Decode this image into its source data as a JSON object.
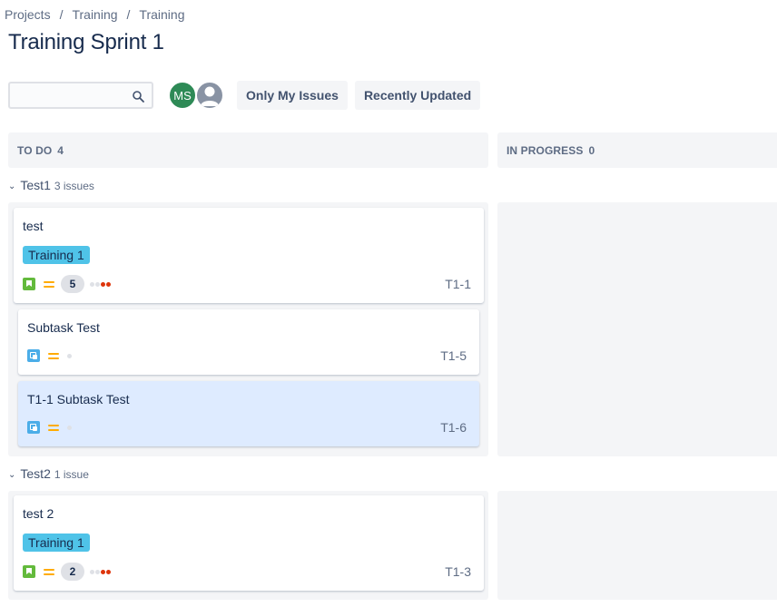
{
  "breadcrumb": [
    "Projects",
    "Training",
    "Training"
  ],
  "page_title": "Training Sprint 1",
  "search": {
    "value": "",
    "placeholder": ""
  },
  "avatars": [
    {
      "initials": "MS",
      "color": "#2e8a56"
    },
    {
      "initials": "",
      "color": "#8993a4"
    }
  ],
  "filters": {
    "only_my_issues": "Only My Issues",
    "recently_updated": "Recently Updated"
  },
  "columns": [
    {
      "name": "TO DO",
      "count": "4"
    },
    {
      "name": "IN PROGRESS",
      "count": "0"
    }
  ],
  "swimlanes": [
    {
      "name": "Test1",
      "count": "3 issues",
      "cards": [
        {
          "summary": "test",
          "epic": "Training 1",
          "points": "5",
          "key": "T1-1",
          "type": "story-icon"
        },
        {
          "summary": "Subtask Test",
          "key": "T1-5",
          "type": "subtask-icon"
        },
        {
          "summary": "T1-1 Subtask Test",
          "key": "T1-6",
          "type": "subtask-icon"
        }
      ]
    },
    {
      "name": "Test2",
      "count": "1 issue",
      "cards": [
        {
          "summary": "test 2",
          "epic": "Training 1",
          "points": "2",
          "key": "T1-3",
          "type": "story-icon"
        }
      ]
    }
  ],
  "colors": {
    "epic": "#4fc3e8",
    "story": "#63ba3c",
    "subtask": "#4bade8",
    "priority_medium": "#ffab00",
    "selected_card": "#deebff"
  }
}
